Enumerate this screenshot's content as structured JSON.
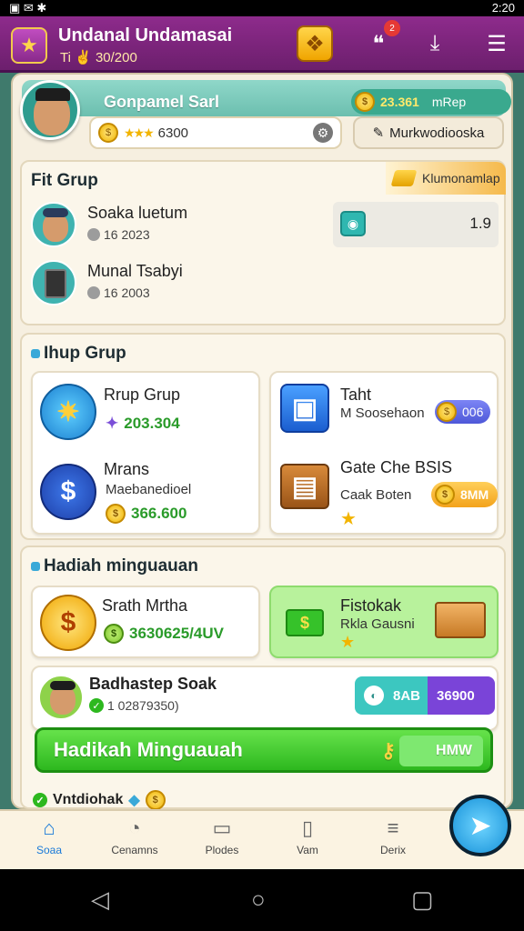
{
  "status_bar": {
    "left": "▣ ✉ ✱",
    "time": "2:20"
  },
  "header": {
    "title": "Undanal Undamasai",
    "subtitle": "Ti ✌ 30/200",
    "notification_count": "2"
  },
  "profile": {
    "name": "Gonpamel Sarl",
    "coin_amount": "23.361",
    "coin_rate": "mRep",
    "search_value": "6300",
    "market_label": "Murkwodiooska"
  },
  "fit_group": {
    "title": "Fit Grup",
    "tag_label": "Klumonamlap",
    "members": [
      {
        "name": "Soaka luetum",
        "sub": "16 2023"
      },
      {
        "name": "Munal Tsabyi",
        "sub": "16 2003"
      }
    ],
    "stat_value": "1.9"
  },
  "group_section": {
    "title": "Ihup Grup",
    "tiles": [
      {
        "title": "Rrup Grup",
        "value": "203.304"
      },
      {
        "title": "Taht",
        "sub": "M Soosehaon",
        "pill": "006"
      },
      {
        "title": "Mrans",
        "sub": "Maebanedioel",
        "value": "366.600"
      },
      {
        "title": "Gate Che BSIS",
        "sub": "Caak Boten",
        "pill": "8MM"
      }
    ]
  },
  "weekly_section": {
    "title": "Hadiah minguauan",
    "tiles": [
      {
        "title": "Srath Mrtha",
        "value": "3630625/4UV"
      },
      {
        "title": "Fistokak",
        "sub": "Rkla Gausni"
      }
    ],
    "player": {
      "name": "Badhastep Soak",
      "sub": "1 02879350)",
      "pill_left": "8AB",
      "pill_right": "36900"
    },
    "button_label": "Hadikah Minguauah",
    "button_right": "HMW",
    "voucher_label": "Vntdiohak"
  },
  "bottom_nav": [
    {
      "label": "Soaa",
      "icon": "home-icon"
    },
    {
      "label": "Cenamns",
      "icon": "search-icon"
    },
    {
      "label": "Plodes",
      "icon": "briefcase-icon"
    },
    {
      "label": "Vam",
      "icon": "document-icon"
    },
    {
      "label": "Derix",
      "icon": "stack-icon"
    }
  ],
  "colors": {
    "header": "#8e2b8c",
    "accent_green": "#2db81f",
    "nav_active": "#1a7ad8"
  }
}
